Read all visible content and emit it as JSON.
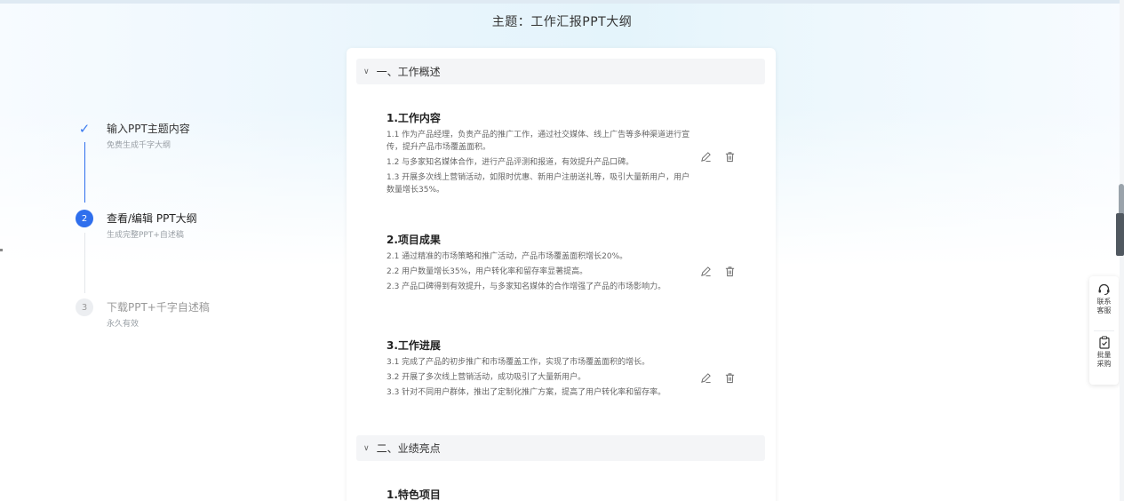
{
  "page_title": "主题：工作汇报PPT大纲",
  "steps": [
    {
      "index": "✓",
      "title": "输入PPT主题内容",
      "subtitle": "免费生成千字大纲",
      "state": "done"
    },
    {
      "index": "2",
      "title": "查看/编辑 PPT大纲",
      "subtitle": "生成完整PPT+自述稿",
      "state": "active"
    },
    {
      "index": "3",
      "title": "下载PPT+千字自述稿",
      "subtitle": "永久有效",
      "state": "todo"
    }
  ],
  "sections": [
    {
      "title": "一、工作概述",
      "items": [
        {
          "title": "1.工作内容",
          "lines": [
            "1.1 作为产品经理，负责产品的推广工作，通过社交媒体、线上广告等多种渠道进行宣传，提升产品市场覆盖面积。",
            "1.2 与多家知名媒体合作，进行产品评测和报道，有效提升产品口碑。",
            "1.3 开展多次线上营销活动，如限时优惠、新用户注册送礼等，吸引大量新用户，用户数量增长35%。"
          ]
        },
        {
          "title": "2.项目成果",
          "lines": [
            "2.1 通过精准的市场策略和推广活动，产品市场覆盖面积增长20%。",
            "2.2 用户数量增长35%，用户转化率和留存率显著提高。",
            "2.3 产品口碑得到有效提升，与多家知名媒体的合作增强了产品的市场影响力。"
          ]
        },
        {
          "title": "3.工作进展",
          "lines": [
            "3.1 完成了产品的初步推广和市场覆盖工作，实现了市场覆盖面积的增长。",
            "3.2 开展了多次线上营销活动，成功吸引了大量新用户。",
            "3.3 针对不同用户群体，推出了定制化推广方案，提高了用户转化率和留存率。"
          ]
        }
      ]
    },
    {
      "title": "二、业绩亮点",
      "items": [
        {
          "title": "1.特色项目",
          "lines": []
        }
      ]
    }
  ],
  "float_panel": {
    "contact_label": "联系客服",
    "bulk_label": "批量采购"
  },
  "icons": {
    "chevron": "chevron-down-icon",
    "edit": "edit-icon",
    "delete": "trash-icon",
    "headset": "headset-icon",
    "clipboard": "clipboard-check-icon"
  },
  "colors": {
    "accent": "#2f6fed",
    "check": "#3b7bf0"
  }
}
